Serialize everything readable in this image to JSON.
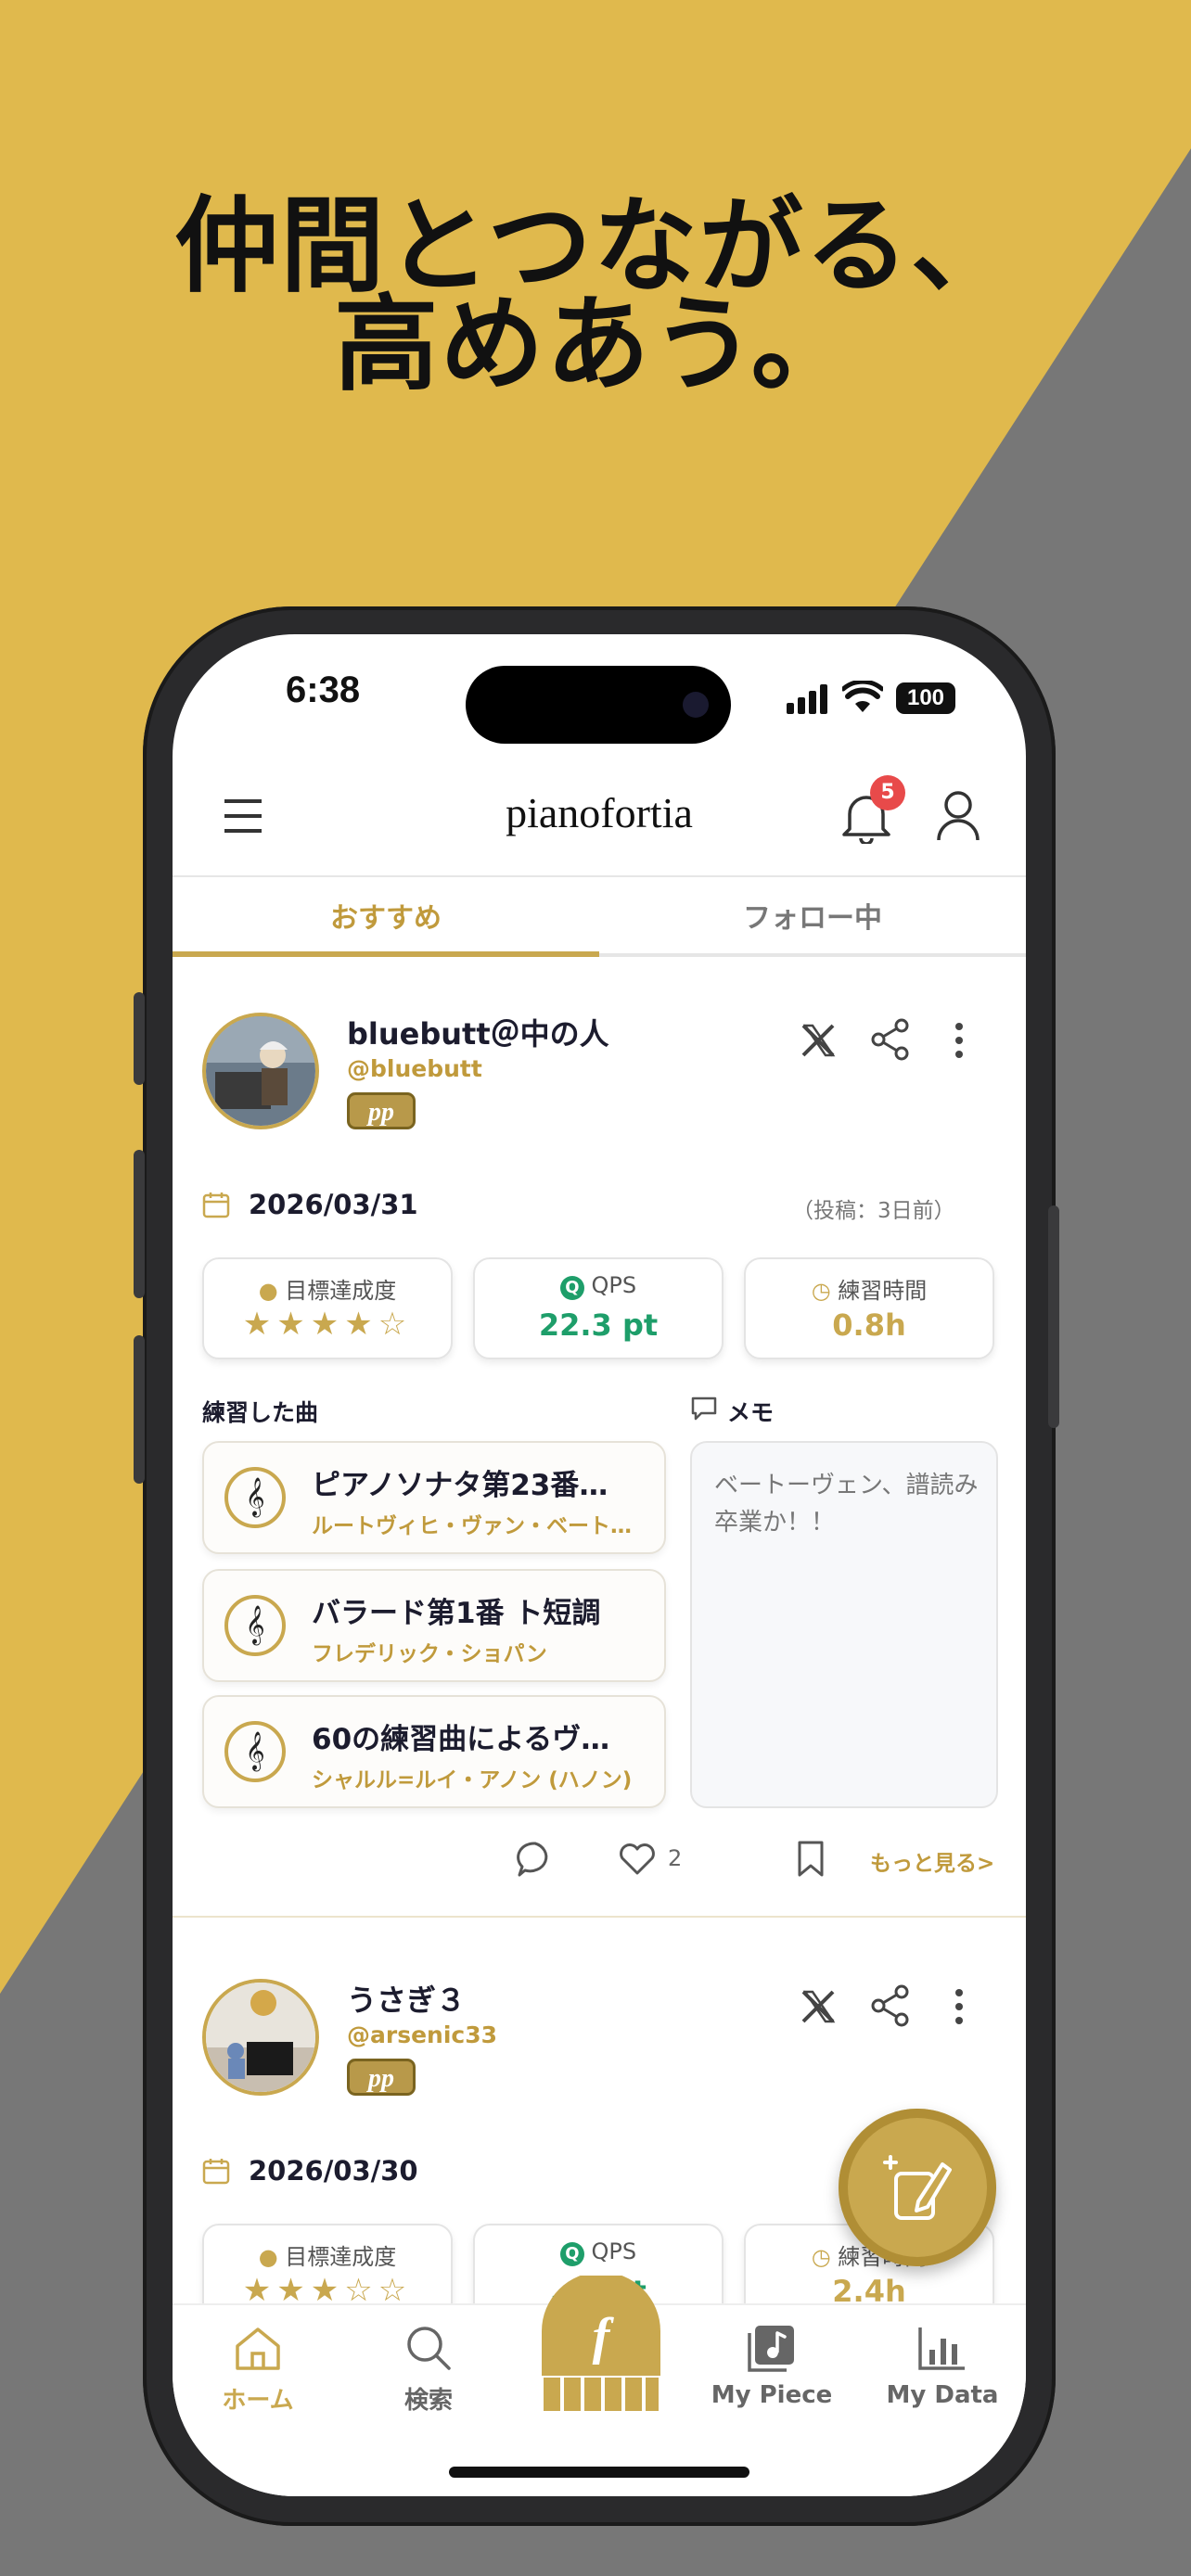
{
  "promo": {
    "headline_line1": "仲間とつながる、",
    "headline_line2": "高めあう。",
    "colors": {
      "gold": "#E3BE4F",
      "gray": "#777777"
    }
  },
  "status_bar": {
    "time": "6:38",
    "battery": "100"
  },
  "app_bar": {
    "logo": "pianofortia",
    "notification_count": "5"
  },
  "tabs": [
    {
      "label": "おすすめ",
      "active": true
    },
    {
      "label": "フォロー中",
      "active": false
    }
  ],
  "posts": [
    {
      "display_name": "bluebutt＠中の人",
      "handle": "@bluebutt",
      "badge": "pp",
      "date": "2026/03/31",
      "posted_ago": "（投稿：3日前）",
      "stats": {
        "goal_label": "目標達成度",
        "goal_stars": "★★★★☆",
        "goal_rating": 4,
        "qps_label": "QPS",
        "qps_value": "22.3 pt",
        "time_label": "練習時間",
        "time_value": "0.8h"
      },
      "practiced_label": "練習した曲",
      "memo_label": "メモ",
      "memo_text": "ベートーヴェン、譜読み卒業か！！",
      "songs": [
        {
          "title": "ピアノソナタ第23番…",
          "composer": "ルートヴィヒ・ヴァン・ベート…"
        },
        {
          "title": "バラード第1番 ト短調",
          "composer": "フレデリック・ショパン"
        },
        {
          "title": "60の練習曲によるヴ…",
          "composer": "シャルル=ルイ・アノン (ハノン)"
        }
      ],
      "like_count": "2",
      "more_label": "もっと見る>"
    },
    {
      "display_name": "うさぎ３",
      "handle": "@arsenic33",
      "badge": "pp",
      "date": "2026/03/30",
      "stats": {
        "goal_label": "目標達成度",
        "goal_stars": "★★★☆☆",
        "goal_rating": 3,
        "qps_label": "QPS",
        "qps_value": "…1 pt",
        "time_label": "練習時間",
        "time_value": "2.4h"
      }
    }
  ],
  "bottom_nav": [
    {
      "label": "ホーム",
      "icon": "home-icon",
      "active": true
    },
    {
      "label": "検索",
      "icon": "search-icon",
      "active": false
    },
    {
      "label": "",
      "icon": "piano-f-icon",
      "active": false
    },
    {
      "label": "My Piece",
      "icon": "music-library-icon",
      "active": false
    },
    {
      "label": "My Data",
      "icon": "bar-chart-icon",
      "active": false
    }
  ]
}
